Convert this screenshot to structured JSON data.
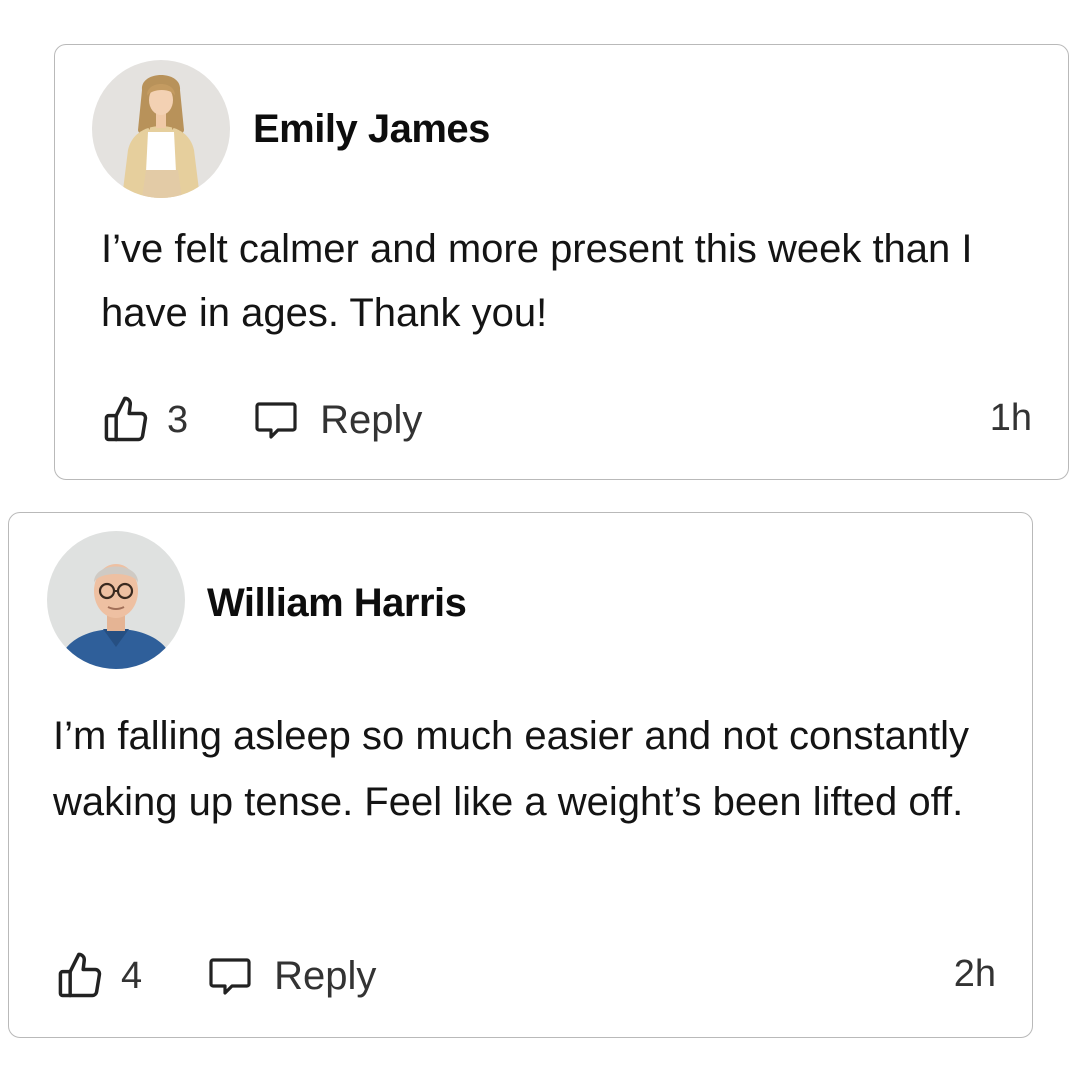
{
  "comments": [
    {
      "author": "Emily James",
      "avatar_icon": "avatar-woman-photo",
      "text": "I’ve felt calmer and more present this week than I have in ages. Thank you!",
      "likes": "3",
      "reply_label": "Reply",
      "time": "1h"
    },
    {
      "author": "William Harris",
      "avatar_icon": "avatar-man-photo",
      "text": "I’m falling asleep so much easier and not constantly waking up tense. Feel like a weight’s been lifted off.",
      "likes": "4",
      "reply_label": "Reply",
      "time": "2h"
    }
  ],
  "colors": {
    "border": "#b9b9b9",
    "text": "#111111",
    "muted": "#333333"
  }
}
